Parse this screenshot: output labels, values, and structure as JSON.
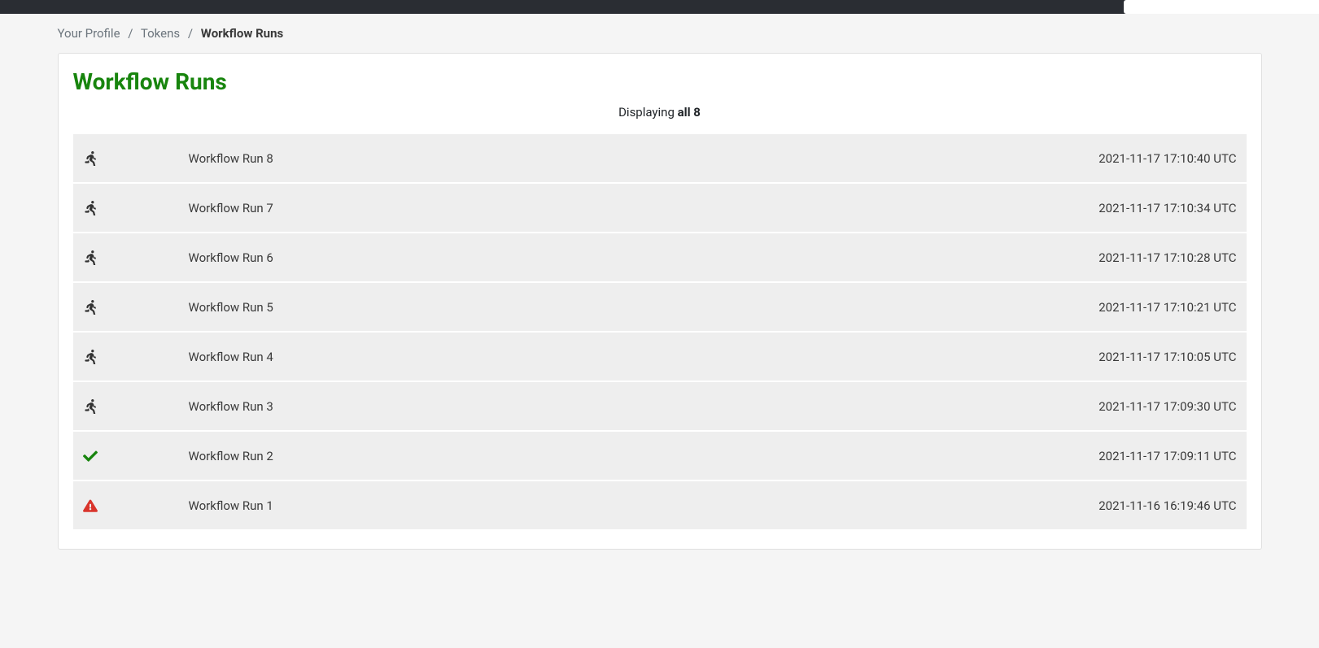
{
  "breadcrumb": {
    "profile": "Your Profile",
    "tokens": "Tokens",
    "current": "Workflow Runs"
  },
  "page": {
    "title": "Workflow Runs",
    "displaying_prefix": "Displaying ",
    "displaying_count": "all 8"
  },
  "runs": [
    {
      "status": "running",
      "name": "Workflow Run 8",
      "time": "2021-11-17 17:10:40 UTC"
    },
    {
      "status": "running",
      "name": "Workflow Run 7",
      "time": "2021-11-17 17:10:34 UTC"
    },
    {
      "status": "running",
      "name": "Workflow Run 6",
      "time": "2021-11-17 17:10:28 UTC"
    },
    {
      "status": "running",
      "name": "Workflow Run 5",
      "time": "2021-11-17 17:10:21 UTC"
    },
    {
      "status": "running",
      "name": "Workflow Run 4",
      "time": "2021-11-17 17:10:05 UTC"
    },
    {
      "status": "running",
      "name": "Workflow Run 3",
      "time": "2021-11-17 17:09:30 UTC"
    },
    {
      "status": "succeeded",
      "name": "Workflow Run 2",
      "time": "2021-11-17 17:09:11 UTC"
    },
    {
      "status": "failed",
      "name": "Workflow Run 1",
      "time": "2021-11-16 16:19:46 UTC"
    }
  ]
}
